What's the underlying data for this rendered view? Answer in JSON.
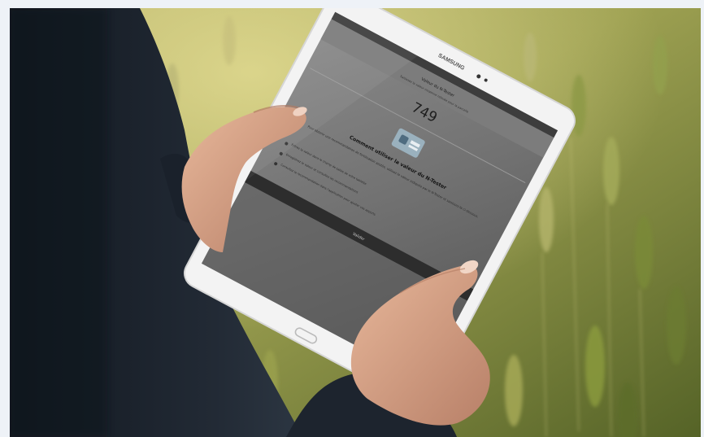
{
  "photo": {
    "subject": "Person holding a tablet in a wheat field",
    "tablet": {
      "brand": "SAMSUNG",
      "screen": {
        "header_title": "Valeur du N-Tester",
        "header_subtitle": "Saisissez la valeur moyenne relevée pour la parcelle",
        "value": "749",
        "help_title": "Comment utiliser la valeur du N-Tester",
        "help_paragraph": "Pour obtenir une recommandation de fertilisation azotée, utilisez la valeur indiquée par le N-Tester et saisissez-la ci-dessous.",
        "steps": [
          "Entrez la valeur dans le champ de saisie de votre tablette",
          "Enregistrez la valeur et consultez les recommandations",
          "Consultez la recommandation dans l'application pour ajuster vos apports"
        ],
        "button_label": "Valider"
      }
    },
    "colors": {
      "frame_bg": "#eef2f7",
      "field_light": "#c4c070",
      "field_dark": "#4d5a25",
      "jacket": "#1f2630",
      "tablet_body": "#f2f2f2",
      "screen_dim": "#6f6f6f",
      "skin": "#d9a489"
    }
  }
}
